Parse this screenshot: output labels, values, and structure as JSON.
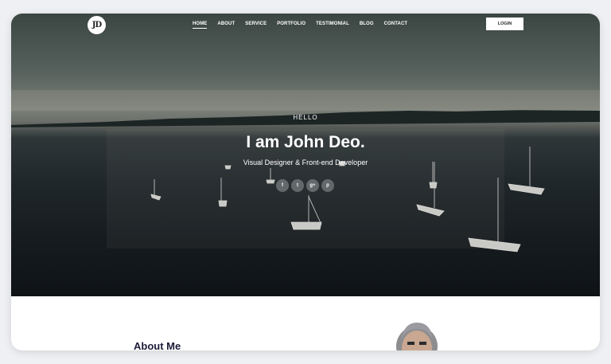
{
  "logo": {
    "text": "JD"
  },
  "nav": {
    "items": [
      {
        "label": "HOME",
        "active": true
      },
      {
        "label": "ABOUT"
      },
      {
        "label": "SERVICE"
      },
      {
        "label": "PORTFOLIO"
      },
      {
        "label": "TESTIMONIAL"
      },
      {
        "label": "BLOG"
      },
      {
        "label": "CONTACT"
      }
    ],
    "login_label": "LOGIN"
  },
  "hero": {
    "greeting": "HELLO",
    "name": "I am John Deo.",
    "role": "Visual Designer & Front-end Developer",
    "socials": [
      {
        "icon": "facebook-icon",
        "glyph": "f"
      },
      {
        "icon": "twitter-icon",
        "glyph": "t"
      },
      {
        "icon": "google-plus-icon",
        "glyph": "g+"
      },
      {
        "icon": "pinterest-icon",
        "glyph": "p"
      }
    ]
  },
  "about": {
    "title": "About Me"
  }
}
